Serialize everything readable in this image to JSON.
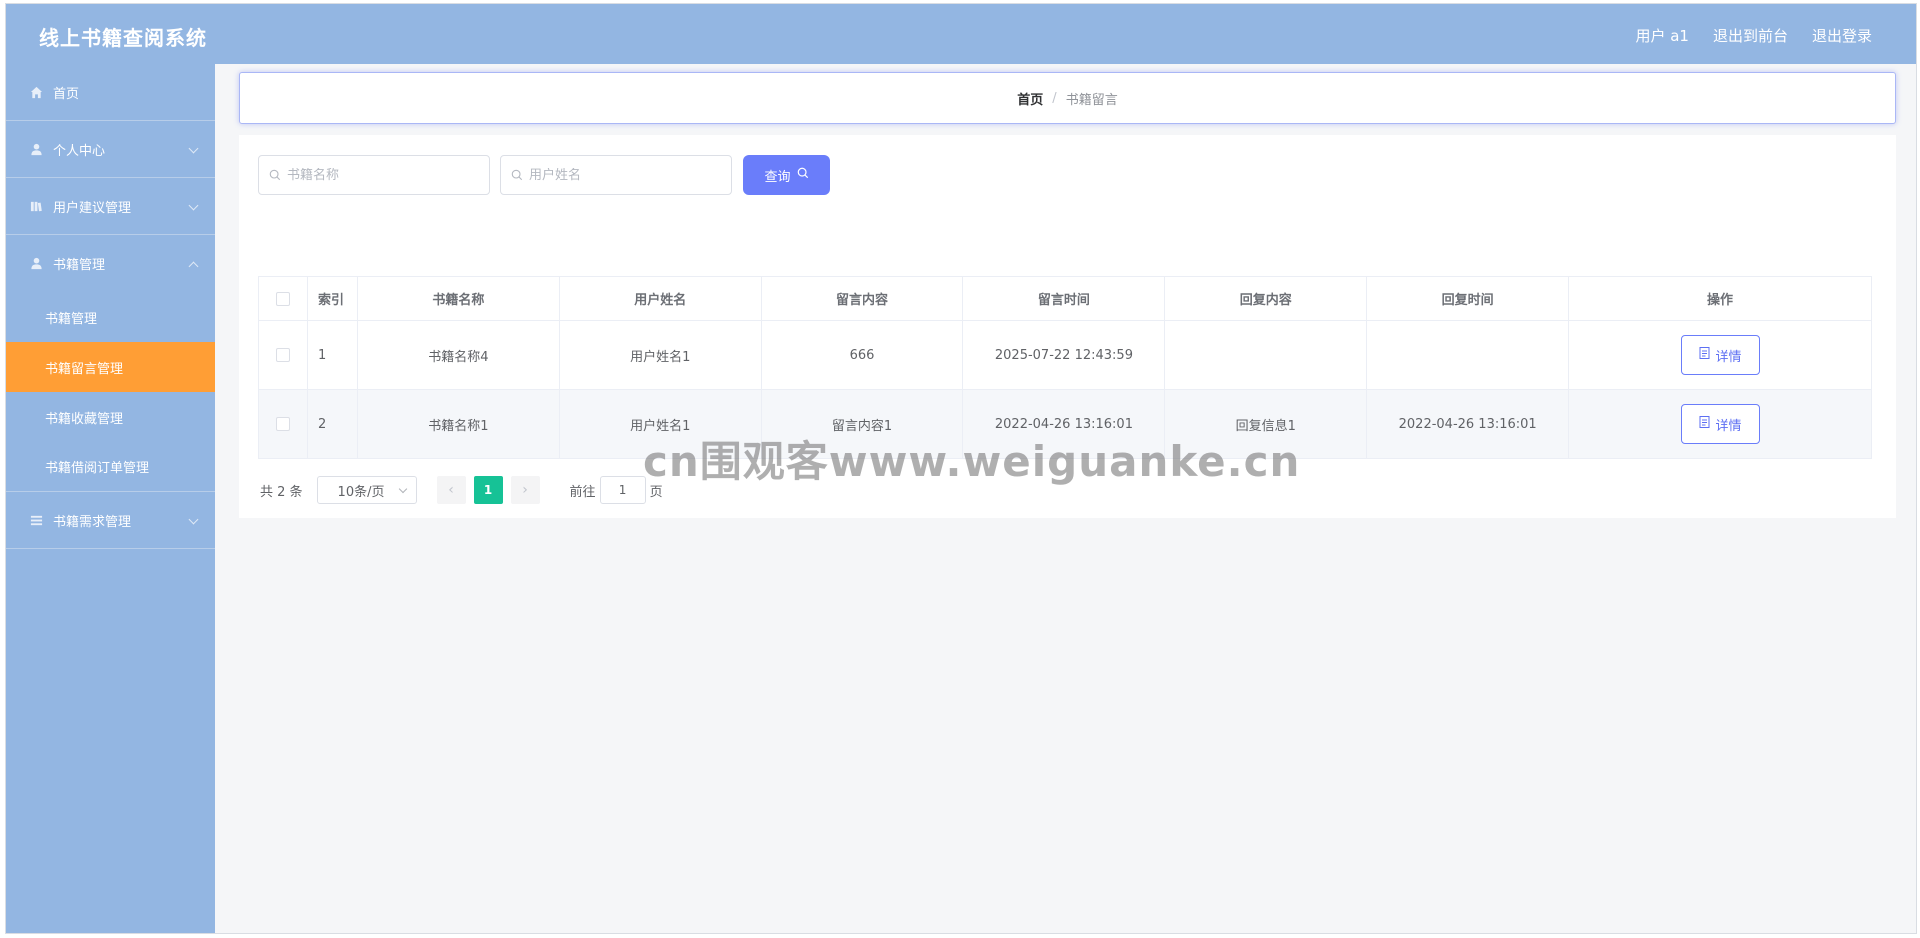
{
  "app": {
    "title": "线上书籍查阅系统"
  },
  "header_links": {
    "user": "用户 a1",
    "frontend": "退出到前台",
    "logout": "退出登录"
  },
  "sidebar": {
    "items": [
      {
        "label": "首页",
        "icon": "home-icon"
      },
      {
        "label": "个人中心",
        "icon": "user-icon"
      },
      {
        "label": "用户建议管理",
        "icon": "book-icon"
      },
      {
        "label": "书籍管理",
        "icon": "user-icon"
      },
      {
        "label": "书籍需求管理",
        "icon": "list-icon"
      }
    ],
    "sub_items": [
      {
        "label": "书籍管理"
      },
      {
        "label": "书籍留言管理",
        "active": true
      },
      {
        "label": "书籍收藏管理"
      },
      {
        "label": "书籍借阅订单管理"
      }
    ],
    "active_color": "#ff9e35",
    "bg_color": "#93b6e2"
  },
  "breadcrumb": {
    "home": "首页",
    "separator": "/",
    "current": "书籍留言"
  },
  "search": {
    "book_placeholder": "书籍名称",
    "user_placeholder": "用户姓名",
    "query_label": "查询"
  },
  "table": {
    "headers": [
      "索引",
      "书籍名称",
      "用户姓名",
      "留言内容",
      "留言时间",
      "回复内容",
      "回复时间",
      "操作"
    ],
    "rows": [
      {
        "index": "1",
        "book": "书籍名称4",
        "user": "用户姓名1",
        "content": "666",
        "time": "2025-07-22 12:43:59",
        "reply": "",
        "reply_time": "",
        "action": "详情"
      },
      {
        "index": "2",
        "book": "书籍名称1",
        "user": "用户姓名1",
        "content": "留言内容1",
        "time": "2022-04-26 13:16:01",
        "reply": "回复信息1",
        "reply_time": "2022-04-26 13:16:01",
        "action": "详情"
      }
    ]
  },
  "pagination": {
    "total": "共 2 条",
    "page_size": "10条/页",
    "current_page": "1",
    "goto_label": "前往",
    "goto_value": "1",
    "page_unit": "页"
  },
  "watermark": "cn围观客www.weiguanke.cn",
  "colors": {
    "primary": "#6a7dfa",
    "pager_active": "#16c296"
  }
}
